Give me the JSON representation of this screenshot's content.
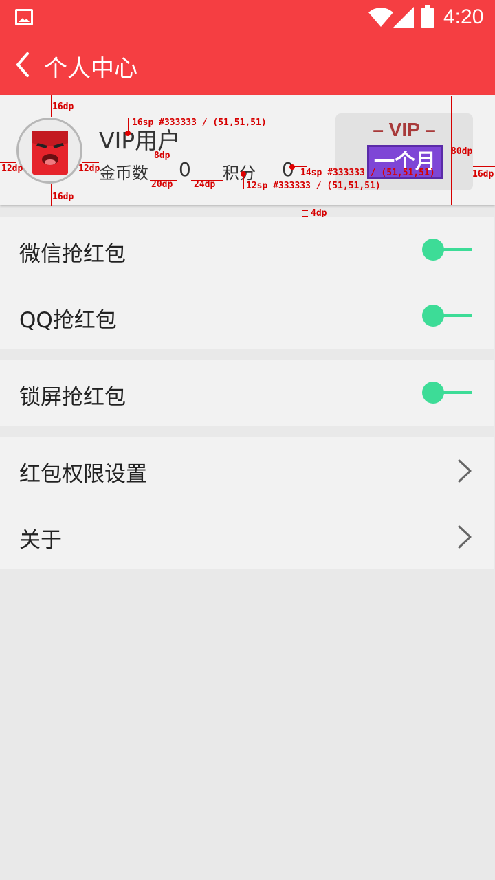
{
  "status_bar": {
    "time": "4:20",
    "icons": [
      "image-icon",
      "wifi-icon",
      "signal-icon",
      "battery-icon"
    ]
  },
  "toolbar": {
    "title": "个人中心",
    "back_icon": "chevron-left-icon"
  },
  "profile": {
    "username": "VIP用户",
    "coins_label": "金币数",
    "coins_value": "0",
    "points_label": "积分",
    "points_value": "0",
    "vip_badge": {
      "label": "– VIP –",
      "duration": "一个月"
    }
  },
  "annotations": {
    "username_spec": "16sp #333333 / (51,51,51)",
    "stats_spec": "12sp #333333 / (51,51,51)",
    "value_spec": "14sp #333333 / (51,51,51)",
    "top_pad": "16dp",
    "bottom_pad": "16dp",
    "left_pad": "12dp",
    "avatar_gap": "12dp",
    "name_gap": "8dp",
    "coin_gap": "20dp",
    "stat_gap": "24dp",
    "header_height": "80dp",
    "right_pad": "16dp",
    "divider": "4dp"
  },
  "settings": {
    "group1": [
      {
        "label": "微信抢红包",
        "type": "toggle"
      },
      {
        "label": "QQ抢红包",
        "type": "toggle"
      }
    ],
    "group2": [
      {
        "label": "锁屏抢红包",
        "type": "toggle"
      }
    ],
    "group3": [
      {
        "label": "红包权限设置",
        "type": "link"
      },
      {
        "label": "关于",
        "type": "link"
      }
    ]
  },
  "colors": {
    "primary": "#f53e42",
    "toggle_on": "#3ddc97",
    "text": "#333333",
    "vip_purple": "#7e46d6",
    "annotation": "#d60000"
  }
}
